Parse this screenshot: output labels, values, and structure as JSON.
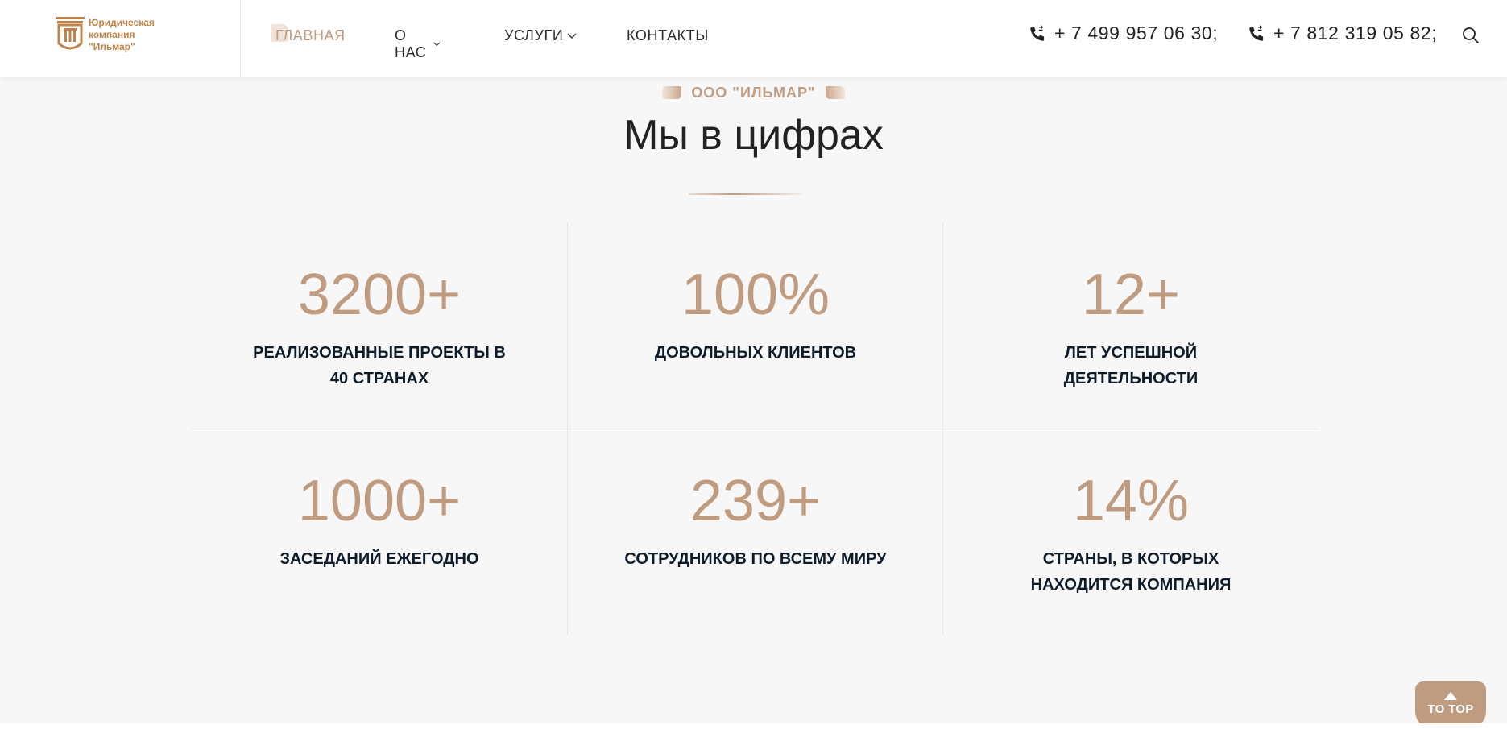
{
  "header": {
    "logo": {
      "text": "Юридическая\nкомпания\n\"Ильмар\"",
      "icon": "column-pillar-icon"
    },
    "nav": [
      {
        "label": "ГЛАВНАЯ",
        "active": true,
        "dropdown": false
      },
      {
        "label": "О НАС",
        "active": false,
        "dropdown": true
      },
      {
        "label": "УСЛУГИ",
        "active": false,
        "dropdown": true
      },
      {
        "label": "КОНТАКТЫ",
        "active": false,
        "dropdown": false
      }
    ],
    "phones": [
      {
        "number": "+ 7 499 957 06 30;",
        "icon": "phone-icon"
      },
      {
        "number": "+ 7 812 319 05 82;",
        "icon": "phone-icon"
      }
    ],
    "search_icon": "search-icon"
  },
  "section": {
    "eyebrow": "ООО \"ИЛЬМАР\"",
    "title": "Мы в цифрах"
  },
  "stats": [
    {
      "value": "3200+",
      "label": "РЕАЛИЗОВАННЫЕ ПРОЕКТЫ В 40 СТРАНАХ"
    },
    {
      "value": "100%",
      "label": "ДОВОЛЬНЫХ КЛИЕНТОВ"
    },
    {
      "value": "12+",
      "label": "ЛЕТ УСПЕШНОЙ ДЕЯТЕЛЬНОСТИ"
    },
    {
      "value": "1000+",
      "label": "ЗАСЕДАНИЙ ЕЖЕГОДНО"
    },
    {
      "value": "239+",
      "label": "СОТРУДНИКОВ ПО ВСЕМУ МИРУ"
    },
    {
      "value": "14%",
      "label": "СТРАНЫ, В КОТОРЫХ НАХОДИТСЯ КОМПАНИЯ"
    }
  ],
  "to_top": {
    "label": "TO TOP",
    "icon": "arrow-up-icon"
  },
  "colors": {
    "accent": "#bf9b80",
    "logo": "#c0834a",
    "text_dark": "#0d1b2a",
    "background": "#f7f7f7"
  }
}
